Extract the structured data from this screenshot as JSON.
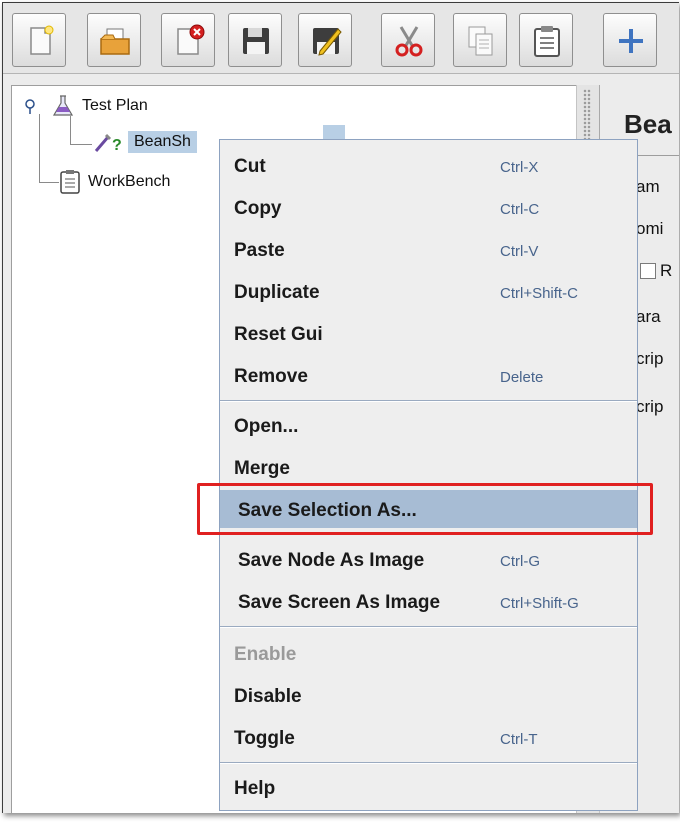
{
  "toolbar": {
    "buttons": [
      {
        "icon": "new-icon"
      },
      {
        "icon": "open-icon"
      },
      {
        "icon": "close-icon"
      },
      {
        "icon": "save-icon"
      },
      {
        "icon": "edit-icon"
      },
      {
        "icon": "cut-icon"
      },
      {
        "icon": "copy-icon"
      },
      {
        "icon": "paste-icon"
      },
      {
        "icon": "expand-icon"
      }
    ]
  },
  "tree": {
    "test_plan": "Test Plan",
    "sampler": "BeanSh",
    "workbench": "WorkBench"
  },
  "right_panel": {
    "title": "Bea",
    "row1": "am",
    "row2": "omi",
    "row3": "R",
    "row4": "ara",
    "row5": "crip",
    "row6": "crip"
  },
  "menu": {
    "cut": {
      "label": "Cut",
      "shortcut": "Ctrl-X"
    },
    "copy": {
      "label": "Copy",
      "shortcut": "Ctrl-C"
    },
    "paste": {
      "label": "Paste",
      "shortcut": "Ctrl-V"
    },
    "duplicate": {
      "label": "Duplicate",
      "shortcut": "Ctrl+Shift-C"
    },
    "reset_gui": {
      "label": "Reset Gui",
      "shortcut": ""
    },
    "remove": {
      "label": "Remove",
      "shortcut": "Delete"
    },
    "open": {
      "label": "Open...",
      "shortcut": ""
    },
    "merge": {
      "label": "Merge",
      "shortcut": ""
    },
    "save_selection": {
      "label": "Save Selection As...",
      "shortcut": ""
    },
    "save_node_image": {
      "label": "Save Node As Image",
      "shortcut": "Ctrl-G"
    },
    "save_screen_image": {
      "label": "Save Screen As Image",
      "shortcut": "Ctrl+Shift-G"
    },
    "enable": {
      "label": "Enable",
      "shortcut": ""
    },
    "disable": {
      "label": "Disable",
      "shortcut": ""
    },
    "toggle": {
      "label": "Toggle",
      "shortcut": "Ctrl-T"
    },
    "help": {
      "label": "Help",
      "shortcut": ""
    }
  },
  "colors": {
    "highlight": "#a7bcd4",
    "callout": "#e02020",
    "shortcut": "#48648c",
    "selection": "#b8cfe5"
  }
}
